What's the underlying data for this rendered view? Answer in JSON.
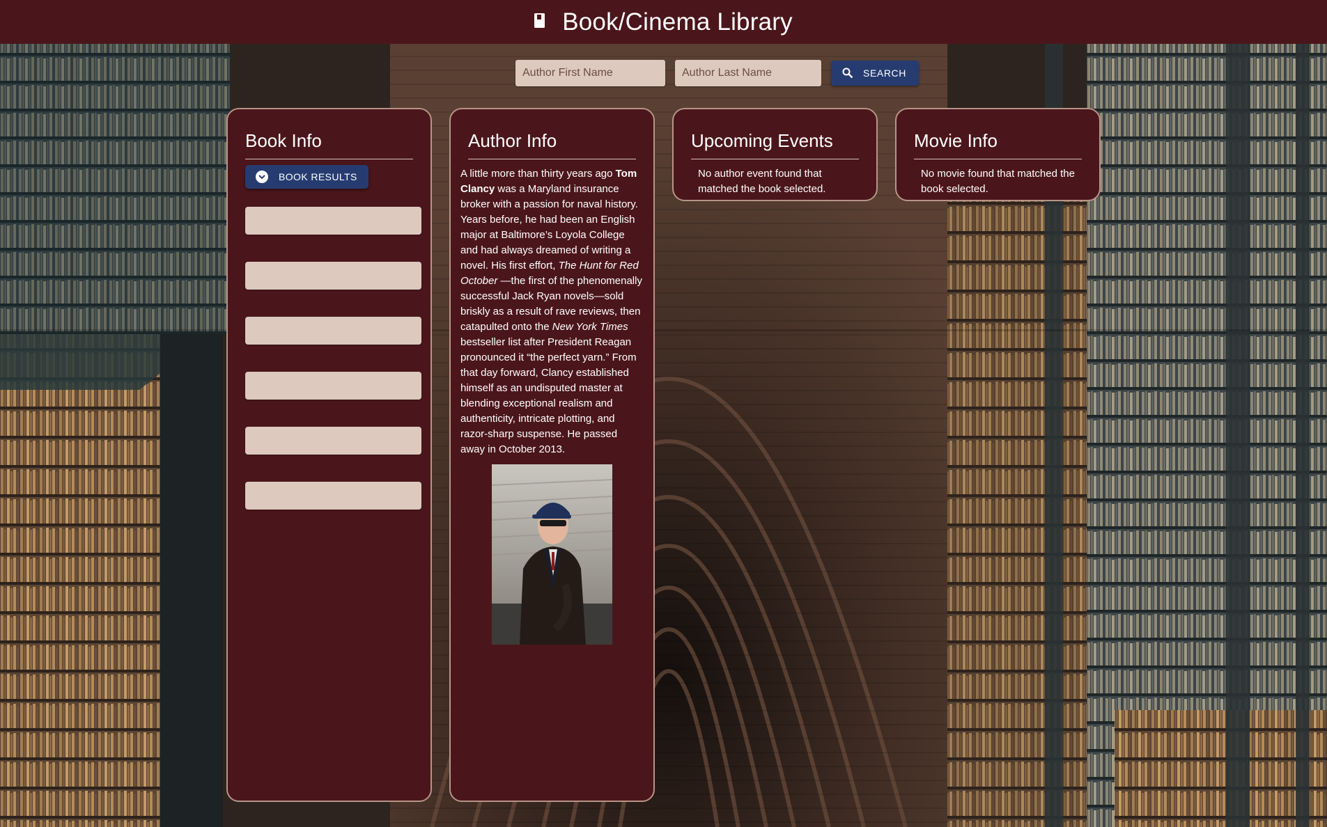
{
  "header": {
    "title": "Book/Cinema Library",
    "icon": "book-icon"
  },
  "search": {
    "first_name_placeholder": "Author First Name",
    "last_name_placeholder": "Author Last Name",
    "button_label": "SEARCH",
    "button_icon": "search-icon"
  },
  "book_info": {
    "title": "Book Info",
    "results_button_label": "BOOK RESULTS",
    "results_button_icon": "chevron-down-circle-icon"
  },
  "author_info": {
    "title": "Author Info",
    "bio": {
      "p1": "A little more than thirty years ago ",
      "name": "Tom Clancy",
      "p2": " was a Maryland insurance broker with a passion for naval history. Years before, he had been an English major at Baltimore’s Loyola College and had always dreamed of writing a novel. His first effort, ",
      "book": "The Hunt for Red October",
      "p3": " —the first of the phenomenally successful Jack Ryan novels—sold briskly as a result of rave reviews, then catapulted onto the ",
      "paper": "New York Times",
      "p4": " bestseller list after President Reagan pronounced it “the perfect yarn.” From that day forward, Clancy established himself as an undisputed master at blending exceptional realism and authenticity, intricate plotting, and razor-sharp suspense. He passed away in October 2013."
    }
  },
  "events": {
    "title": "Upcoming Events",
    "message": "No author event found that matched the book selected."
  },
  "movie": {
    "title": "Movie Info",
    "message": "No movie found that matched the book selected."
  },
  "colors": {
    "header_bg": "#4b161b",
    "panel_bg": "#4b161b",
    "panel_border": "#b89488",
    "button_bg": "#263c71",
    "input_bg": "#ddc9be"
  }
}
